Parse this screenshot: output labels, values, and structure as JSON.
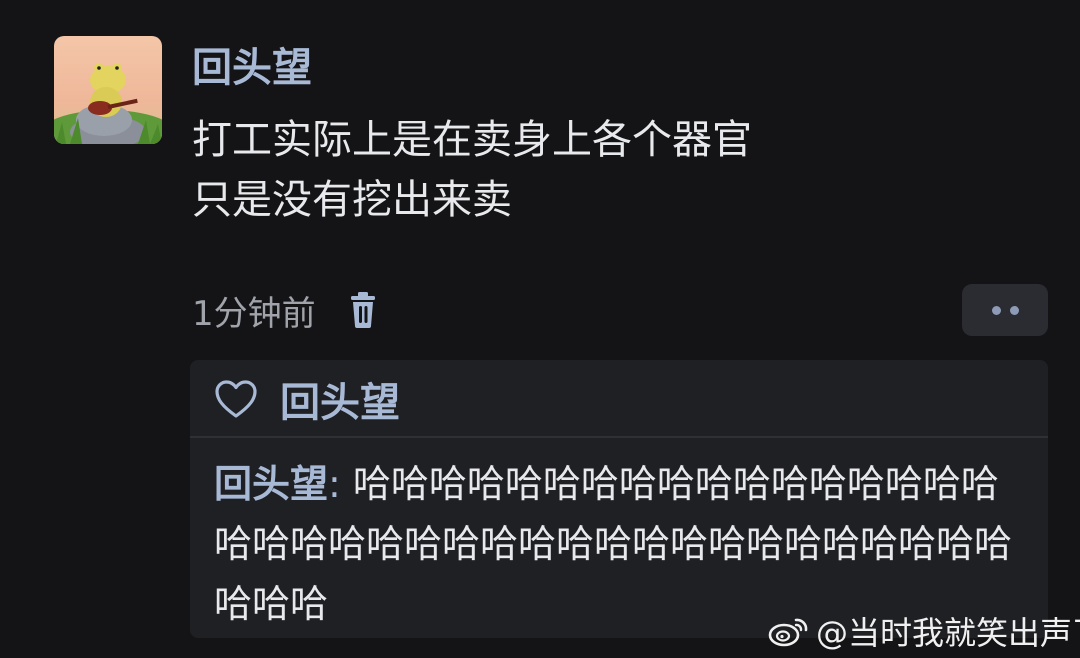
{
  "post": {
    "username": "回头望",
    "text_lines": [
      "打工实际上是在卖身上各个器官",
      "只是没有挖出来卖"
    ],
    "timestamp": "1分钟前"
  },
  "reply_box": {
    "liked_by": "回头望",
    "comment": {
      "author": "回头望",
      "separator": ":",
      "text": "哈哈哈哈哈哈哈哈哈哈哈哈哈哈哈哈哈哈哈哈哈哈哈哈哈哈哈哈哈哈哈哈哈哈哈哈哈哈哈哈哈"
    }
  },
  "watermark": {
    "text": "@当时我就笑出声了"
  },
  "icons": {
    "trash": "trash-icon",
    "more": "more-dots-icon",
    "like": "heart-outline-icon",
    "watermark_logo": "weibo-logo"
  },
  "colors": {
    "background": "#141416",
    "accent_name": "#a8b9d6",
    "body_text": "#e8e9ec",
    "muted_text": "#a0a3aa",
    "card": "#1f2024"
  }
}
